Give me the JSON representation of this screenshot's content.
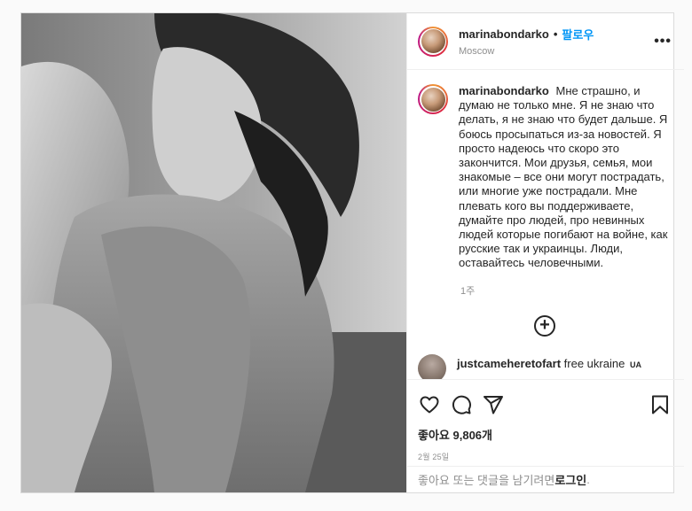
{
  "post": {
    "username": "marinabondarko",
    "follow_label": "팔로우",
    "location": "Moscow",
    "more_label": "•••",
    "caption": "Мне страшно, и думаю не только мне. Я не знаю что делать, я не знаю что будет дальше. Я боюсь просыпаться из-за новостей. Я просто надеюсь что скоро это закончится. Мои друзья, семья, мои знакомые – все они могут пострадать, или многие уже пострадали. Мне плевать кого вы поддерживаете, думайте про людей, про невинных людей которые погибают на войне, как русские так и украинцы. Люди, оставайтесь человечными.",
    "time_ago": "1주",
    "load_more_icon": "plus-circle-icon",
    "comments": [
      {
        "username": "justcameheretofart",
        "text": "free ukraine",
        "flag": "UA"
      }
    ],
    "likes": "좋아요 9,806개",
    "date": "2월 25일",
    "login_prompt_prefix": "좋아요 또는 댓글을 남기려면 ",
    "login_link": "로그인",
    "login_prompt_suffix": "."
  },
  "colors": {
    "accent": "#0095f6",
    "text": "#262626",
    "muted": "#8e8e8e",
    "border": "#dbdbdb"
  },
  "icons": [
    "heart-icon",
    "comment-icon",
    "share-icon",
    "bookmark-icon"
  ]
}
